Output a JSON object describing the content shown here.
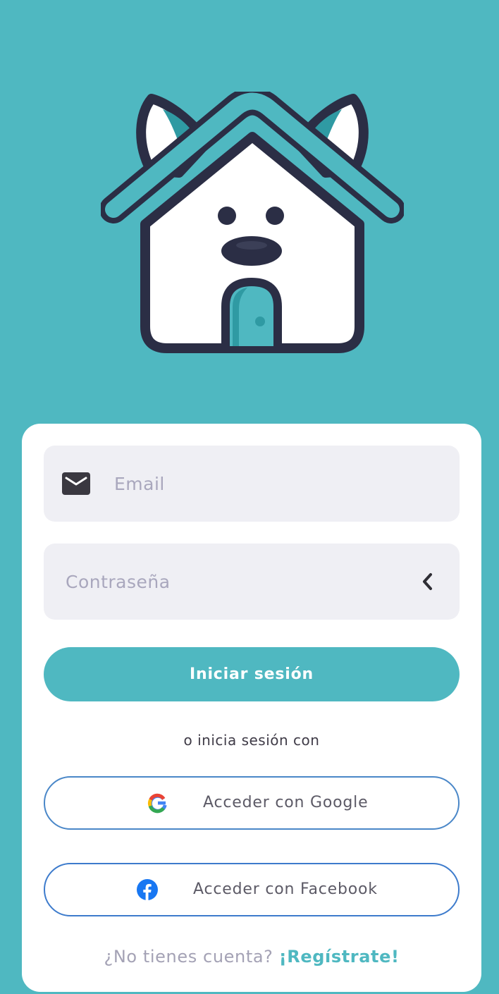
{
  "brand": {
    "logo_icon": "dog-house-logo",
    "primary_color": "#4fb8c1",
    "dark_outline_color": "#2b2e45"
  },
  "login_form": {
    "email": {
      "icon": "mail-icon",
      "placeholder": "Email",
      "value": ""
    },
    "password": {
      "placeholder": "Contraseña",
      "value": "",
      "toggle_icon": "chevron-left-icon"
    },
    "submit_label": "Iniciar sesión"
  },
  "alt_login_text": "o inicia sesión con",
  "social": {
    "google": {
      "icon": "google-icon",
      "label": "Acceder con Google"
    },
    "facebook": {
      "icon": "facebook-icon",
      "label": "Acceder con Facebook"
    }
  },
  "signup": {
    "question": "¿No tienes cuenta?",
    "link_label": "¡Regístrate!"
  }
}
